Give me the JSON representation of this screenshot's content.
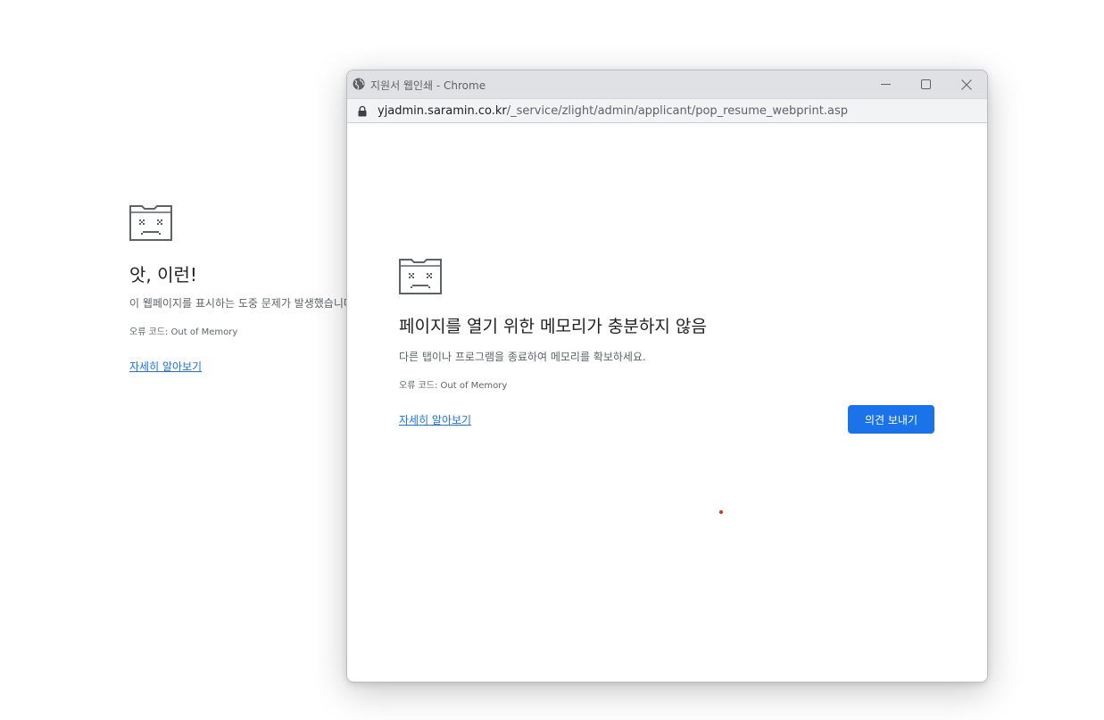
{
  "background_page": {
    "icon": "sad-folder-icon",
    "title": "앗, 이런!",
    "description": "이 웹페이지를 표시하는 도중 문제가 발생했습니다.",
    "error_code": "오류 코드: Out of Memory",
    "learn_more": "자세히 알아보기"
  },
  "popup_window": {
    "title": "지원서 웹인쇄 - Chrome",
    "globe_icon": "globe-icon",
    "controls": {
      "minimize_icon": "minimize-icon",
      "maximize_icon": "maximize-icon",
      "close_icon": "close-icon"
    },
    "address_bar": {
      "lock_icon": "lock-icon",
      "host": "yjadmin.saramin.co.kr",
      "path": "/_service/zlight/admin/applicant/pop_resume_webprint.asp"
    },
    "content": {
      "icon": "sad-folder-icon",
      "title": "페이지를 열기 위한 메모리가 충분하지 않음",
      "description": "다른 탭이나 프로그램을 종료하여 메모리를 확보하세요.",
      "error_code": "오류 코드: Out of Memory",
      "learn_more": "자세히 알아보기",
      "feedback_button": "의견 보내기"
    }
  },
  "colors": {
    "accent": "#1a73e8",
    "title_text": "#202124",
    "secondary_text": "#5f6368",
    "titlebar": "#dfe1e5",
    "addressbar": "#f1f3f4",
    "red_dot": "#d93025"
  }
}
